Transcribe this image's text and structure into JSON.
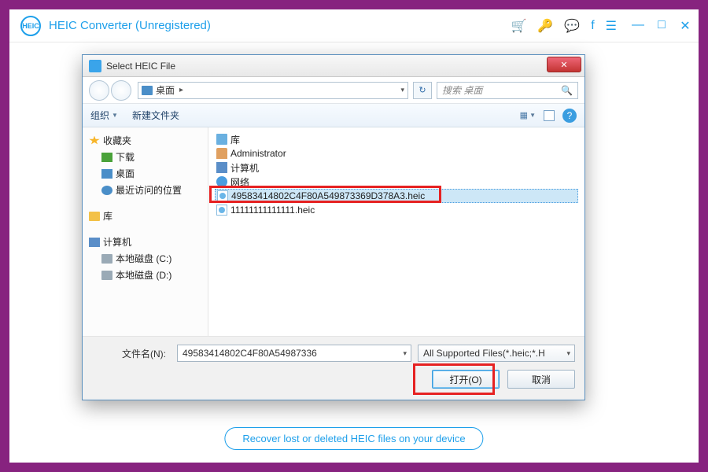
{
  "app": {
    "title": "HEIC Converter (Unregistered)",
    "recover_link": "Recover lost or deleted HEIC files on your device"
  },
  "dialog": {
    "title": "Select HEIC File",
    "address": "桌面",
    "address_sep": "▸",
    "search_placeholder": "搜索 桌面",
    "toolbar": {
      "organize": "组织",
      "new_folder": "新建文件夹"
    },
    "tree": {
      "favorites": "收藏夹",
      "downloads": "下载",
      "desktop": "桌面",
      "recent": "最近访问的位置",
      "library": "库",
      "computer": "计算机",
      "disk_c": "本地磁盘 (C:)",
      "disk_d": "本地磁盘 (D:)"
    },
    "list": {
      "library": "库",
      "admin": "Administrator",
      "computer": "计算机",
      "network": "网络",
      "file_selected": "49583414802C4F80A549873369D378A3.heic",
      "file_other": "11111111111111.heic"
    },
    "filename_label": "文件名(N):",
    "filename_value": "49583414802C4F80A54987336",
    "filter_value": "All Supported Files(*.heic;*.H",
    "open_btn": "打开(O)",
    "cancel_btn": "取消"
  }
}
